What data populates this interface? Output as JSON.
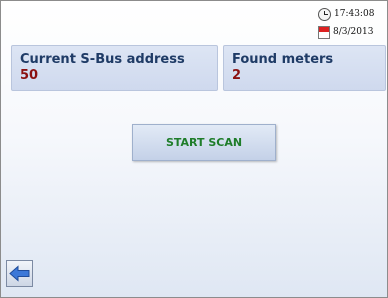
{
  "status": {
    "time": "17:43:08",
    "date": "8/3/2013",
    "clock_icon": "clock-icon",
    "calendar_icon": "calendar-icon"
  },
  "address_panel": {
    "label": "Current S-Bus address",
    "value": "50"
  },
  "meters_panel": {
    "label": "Found meters",
    "value": "2"
  },
  "actions": {
    "start_scan_label": "START SCAN",
    "back_icon": "back-arrow-icon"
  },
  "colors": {
    "value_text": "#8b1010",
    "label_text": "#1f3b66",
    "button_text": "#1f7d2a",
    "arrow": "#3c78d8"
  }
}
